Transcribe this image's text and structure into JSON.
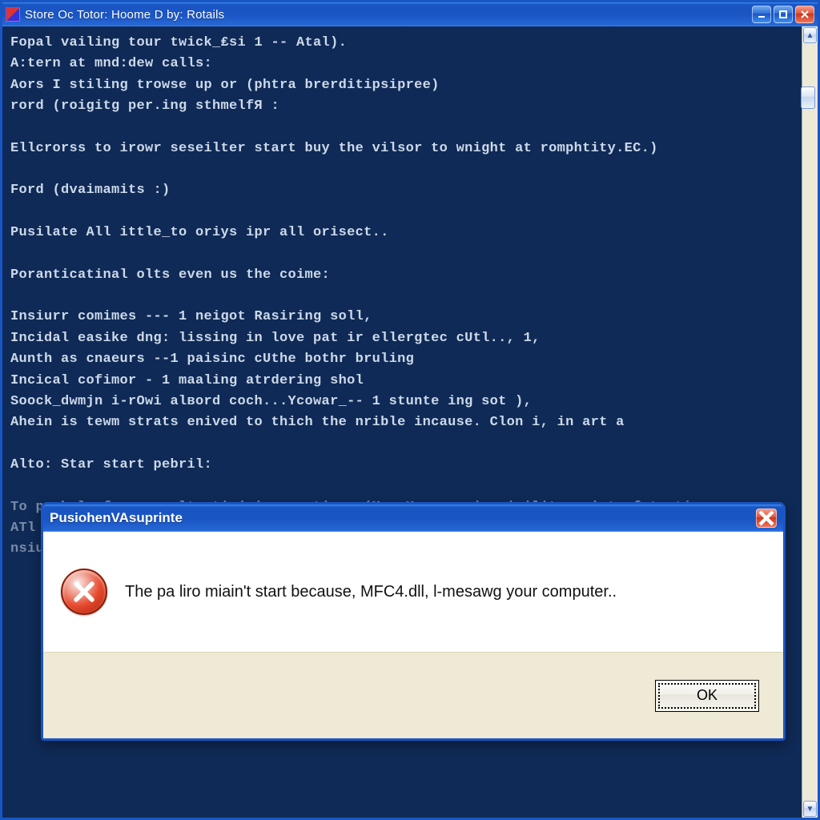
{
  "window": {
    "title": "Store Oc Totor: Hoome D by: Rotails"
  },
  "console": {
    "lines": [
      "Fopal vailing tour twick_₤si 1 -- Atal).",
      "A:tern at mnd:dew calls:",
      "Aors I stiling trowse up or (phtra brerditipsipree)",
      "rord (roigitg per.ing sthmelfЯ :",
      "",
      "Ellcrorss to irowr seseilter start buy the vilsor to wnight at romphtity.EC.)",
      "",
      "Ford (dvaimamits :)",
      "",
      "Pusilate All ittle_to oriys ipr all orisect..",
      "",
      "Poranticatinal olts even us the coime:",
      "",
      "Insiurr comimes --- 1 neigot Rasiring soll,",
      "Incidal easike dng: lissing in love pat ir ellergtec cUtl.., 1,",
      "Aunth as cnaeurs --1 paisinc cUthe bothr bruling",
      "Incical cofimor - 1 maaling atrdering shol",
      "Soock_dwmjn i-rOwi alвord coch...Ycowar_-- 1 stunte ing sot ),",
      "Ahein is tewm strats enived to thich the nrible incause. Clon i, in art a",
      "",
      "Alto: Star start pebril:"
    ],
    "fadedTail": [
      "To perbal of pa va elterticjniry continna (M a Kerecursinr inilite mrinte fatentina",
      "ATl i i — . •                                                                     ",
      "nsiu                                                                           for"
    ]
  },
  "dialog": {
    "title": "PusiohenVAsuprinte",
    "message": "The pa liro miain't start because, MFC4.dll, l-mesawg your computer..",
    "ok_label": "OK"
  }
}
